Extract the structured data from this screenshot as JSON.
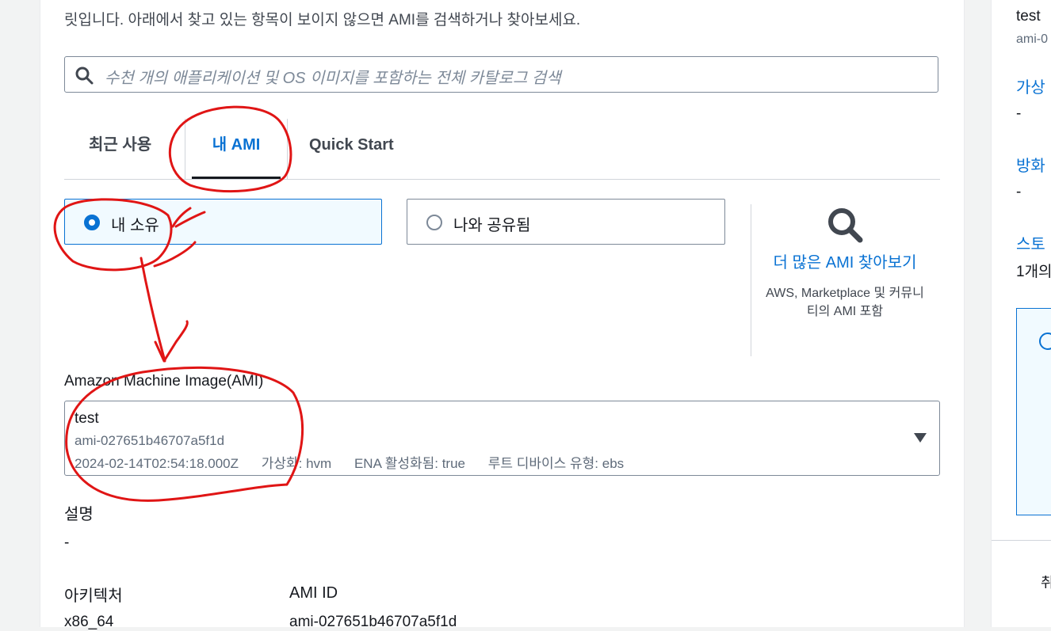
{
  "intro_text": "릿입니다. 아래에서 찾고 있는 항목이 보이지 않으면 AMI를 검색하거나 찾아보세요.",
  "search": {
    "placeholder": "수천 개의 애플리케이션 및 OS 이미지를 포함하는 전체 카탈로그 검색"
  },
  "tabs": {
    "recent": "최근 사용",
    "my_ami": "내 AMI",
    "quick_start": "Quick Start",
    "active": "my_ami"
  },
  "ownership": {
    "owned_label": "내 소유",
    "shared_label": "나와 공유됨",
    "selected": "owned"
  },
  "browse": {
    "link": "더 많은 AMI 찾아보기",
    "sub": "AWS, Marketplace 및 커뮤니티의 AMI 포함"
  },
  "ami": {
    "label": "Amazon Machine Image(AMI)",
    "name": "test",
    "id": "ami-027651b46707a5f1d",
    "date": "2024-02-14T02:54:18.000Z",
    "virtualization": "가상화: hvm",
    "ena": "ENA 활성화됨: true",
    "root_device": "루트 디바이스 유형: ebs"
  },
  "details": {
    "description_label": "설명",
    "description_value": "-",
    "architecture_label": "아키텍처",
    "architecture_value": "x86_64",
    "ami_id_label": "AMI ID",
    "ami_id_value": "ami-027651b46707a5f1d"
  },
  "side": {
    "name": "test",
    "ami_id": "ami-0",
    "virt_label": "가상",
    "virt_value": "-",
    "firewall_label": "방화",
    "firewall_value": "-",
    "storage_label": "스토",
    "storage_value": "1개의",
    "cancel": "취"
  },
  "colors": {
    "accent": "#0972d3",
    "annotation": "#e01515"
  }
}
